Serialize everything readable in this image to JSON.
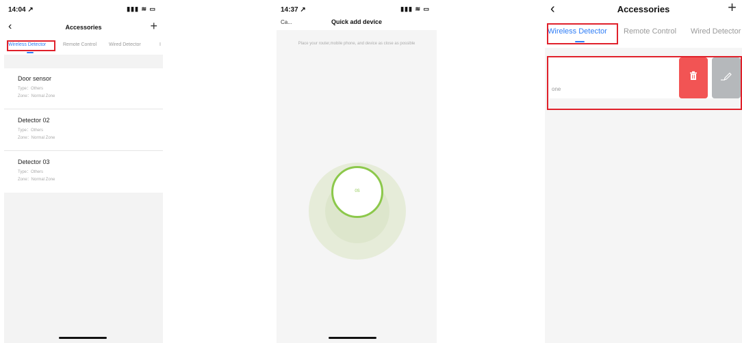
{
  "panel1": {
    "status": {
      "time": "14:04 ↗",
      "icons": "▮▮▮ ≋ ▭"
    },
    "nav": {
      "back_icon": "chevron-left-icon",
      "title": "Accessories",
      "add_icon": "plus-icon"
    },
    "tabs": [
      "Wireless Detector",
      "Remote Control",
      "Wired Detector",
      "I"
    ],
    "items": [
      {
        "name": "Door sensor",
        "type": "Type：Others",
        "zone": "Zone：Normal Zone"
      },
      {
        "name": "Detector 02",
        "type": "Type：Others",
        "zone": "Zone：Normal Zone"
      },
      {
        "name": "Detector 03",
        "type": "Type：Others",
        "zone": "Zone：Normal Zone"
      }
    ]
  },
  "panel2": {
    "status": {
      "time": "14:37 ↗",
      "icons": "▮▮▮ ≋ ▭"
    },
    "nav": {
      "cancel": "Ca...",
      "title": "Quick add device"
    },
    "hint": "Place your router,mobile phone,  and device as close as possible",
    "timer": "0S"
  },
  "panel3": {
    "nav": {
      "back_icon": "chevron-left-icon",
      "title": "Accessories",
      "add_icon": "plus-icon"
    },
    "tabs": [
      "Wireless Detector",
      "Remote Control",
      "Wired Detector"
    ],
    "row_label": "one",
    "delete_icon": "trash-icon",
    "edit_icon": "pencil-icon"
  },
  "colors": {
    "accent": "#2d7cf6",
    "delete": "#f25454",
    "edit": "#b5b8bb",
    "progress": "#8cc84b",
    "highlight": "#e0202a"
  }
}
